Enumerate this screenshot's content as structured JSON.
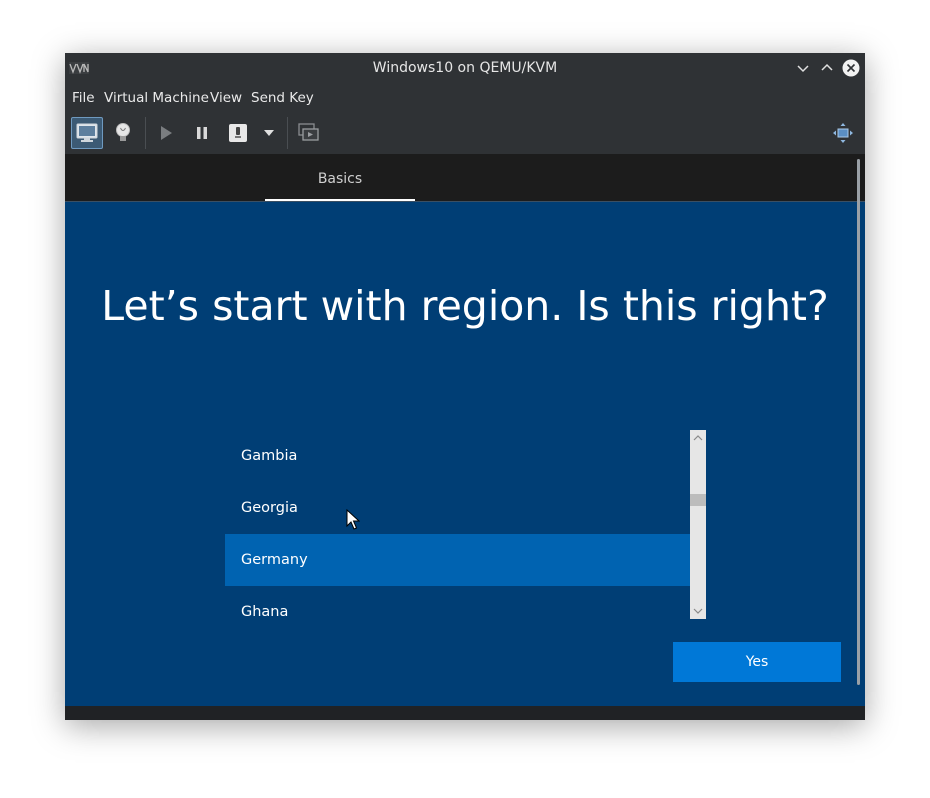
{
  "window": {
    "title": "Windows10 on QEMU/KVM",
    "controls": {
      "minimize_icon": "chevron-down-icon",
      "maximize_icon": "chevron-up-icon",
      "close_icon": "close-icon"
    }
  },
  "menubar": {
    "items": [
      "File",
      "Virtual Machine",
      "View",
      "Send Key"
    ]
  },
  "toolbar": {
    "buttons": [
      {
        "name": "console-view",
        "icon": "monitor-icon",
        "active": true
      },
      {
        "name": "details-view",
        "icon": "lightbulb-icon",
        "active": false
      },
      {
        "name": "run",
        "icon": "play-icon",
        "active": false
      },
      {
        "name": "pause",
        "icon": "pause-icon",
        "active": false
      },
      {
        "name": "shutdown",
        "icon": "power-icon",
        "active": false
      },
      {
        "name": "shutdown-menu",
        "icon": "chevron-down-icon",
        "active": false
      },
      {
        "name": "snapshots",
        "icon": "snapshot-icon",
        "active": false
      },
      {
        "name": "fullscreen",
        "icon": "fullscreen-icon",
        "active": false
      }
    ]
  },
  "oobe": {
    "tab_label": "Basics",
    "heading": "Let’s start with region. Is this right?",
    "regions": [
      {
        "label": "Gambia",
        "selected": false
      },
      {
        "label": "Georgia",
        "selected": false
      },
      {
        "label": "Germany",
        "selected": true
      },
      {
        "label": "Ghana",
        "selected": false
      }
    ],
    "yes_label": "Yes"
  },
  "colors": {
    "guest_background": "#003e75",
    "selected_item": "#0063b1",
    "accent_button": "#0078d7",
    "window_chrome": "#2f3235"
  }
}
